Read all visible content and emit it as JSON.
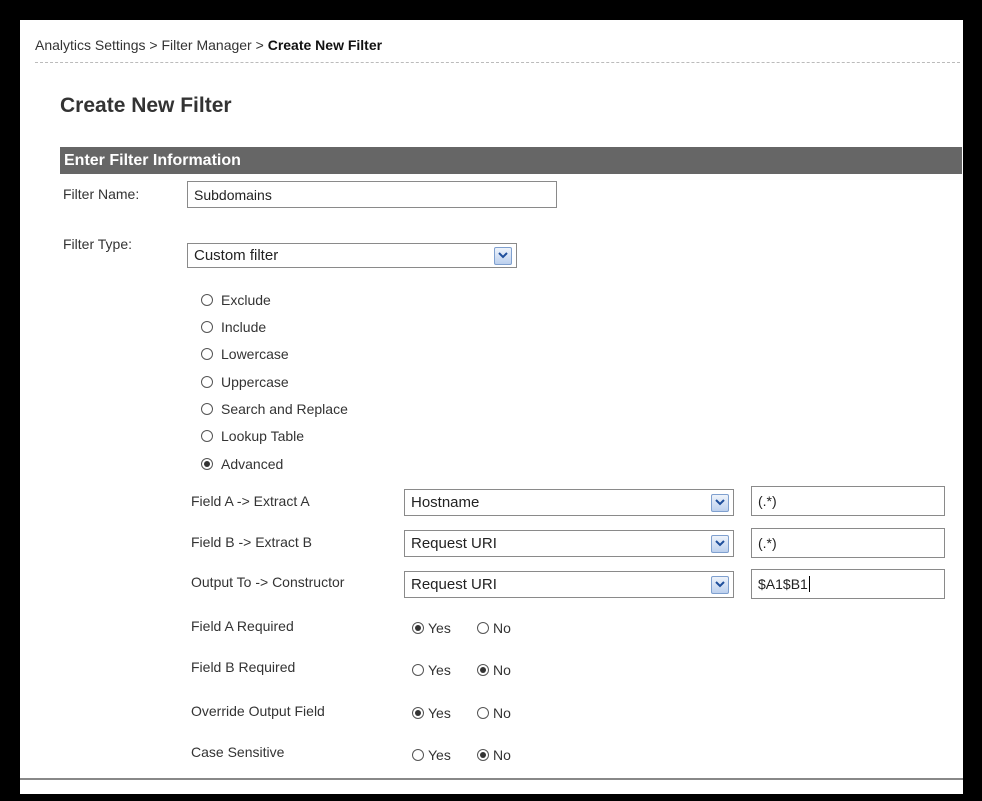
{
  "breadcrumb": {
    "items": [
      "Analytics Settings",
      "Filter Manager"
    ],
    "separator": ">",
    "current": "Create New Filter"
  },
  "page_title": "Create New Filter",
  "section_title": "Enter Filter Information",
  "filter_name": {
    "label": "Filter Name:",
    "value": "Subdomains"
  },
  "filter_type": {
    "label": "Filter Type:",
    "selected": "Custom filter",
    "options": [
      {
        "label": "Exclude",
        "checked": false
      },
      {
        "label": "Include",
        "checked": false
      },
      {
        "label": "Lowercase",
        "checked": false
      },
      {
        "label": "Uppercase",
        "checked": false
      },
      {
        "label": "Search and Replace",
        "checked": false
      },
      {
        "label": "Lookup Table",
        "checked": false
      },
      {
        "label": "Advanced",
        "checked": true
      }
    ]
  },
  "advanced": {
    "field_a": {
      "label": "Field A -> Extract A",
      "field": "Hostname",
      "extract": "(.*)"
    },
    "field_b": {
      "label": "Field B -> Extract B",
      "field": "Request URI",
      "extract": "(.*)"
    },
    "output": {
      "label": "Output To -> Constructor",
      "field": "Request URI",
      "constructor": "$A1$B1"
    },
    "yes_label": "Yes",
    "no_label": "No",
    "field_a_required": {
      "label": "Field A Required",
      "value": "Yes"
    },
    "field_b_required": {
      "label": "Field B Required",
      "value": "No"
    },
    "override_output": {
      "label": "Override Output Field",
      "value": "Yes"
    },
    "case_sensitive": {
      "label": "Case Sensitive",
      "value": "No"
    }
  },
  "colors": {
    "section_bar": "#666666",
    "background": "#ffffff",
    "frame": "#000000"
  }
}
